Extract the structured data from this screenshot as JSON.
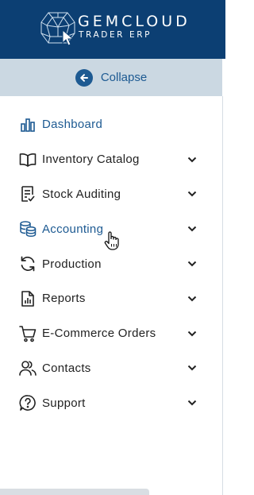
{
  "brand": {
    "name": "GEMCLOUD",
    "tagline": "TRADER ERP"
  },
  "collapse": {
    "label": "Collapse"
  },
  "colors": {
    "header": "#0c3f73",
    "accent": "#1d5a92",
    "collapse_bg": "#cbd8e2"
  },
  "nav": [
    {
      "label": "Dashboard",
      "icon": "bar-chart-icon",
      "active": true
    },
    {
      "label": "Inventory Catalog",
      "icon": "book-icon"
    },
    {
      "label": "Stock Auditing",
      "icon": "checklist-icon"
    },
    {
      "label": "Accounting",
      "icon": "coins-icon",
      "active": true
    },
    {
      "label": "Production",
      "icon": "refresh-icon"
    },
    {
      "label": "Reports",
      "icon": "report-icon"
    },
    {
      "label": "E-Commerce Orders",
      "icon": "cart-icon"
    },
    {
      "label": "Contacts",
      "icon": "users-icon"
    },
    {
      "label": "Support",
      "icon": "help-icon"
    }
  ]
}
